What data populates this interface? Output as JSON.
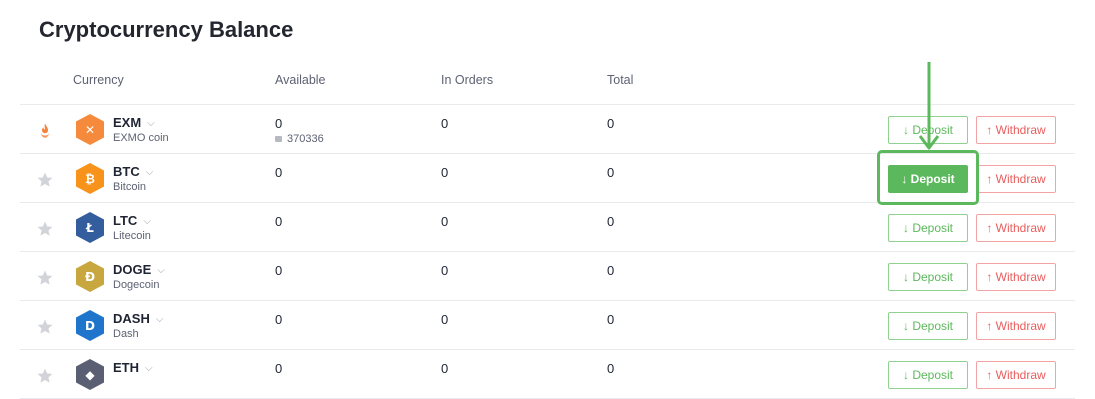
{
  "page": {
    "title": "Cryptocurrency Balance"
  },
  "columns": {
    "currency": "Currency",
    "available": "Available",
    "in_orders": "In Orders",
    "total": "Total"
  },
  "actions": {
    "deposit": "↓ Deposit",
    "withdraw": "↑ Withdraw"
  },
  "rows": [
    {
      "ticker": "EXM",
      "name": "EXMO coin",
      "available": "0",
      "locked": "370336",
      "in_orders": "0",
      "total": "0",
      "icon": "exmo-coin-icon",
      "icon_color": "#f58a3c",
      "glyph": "✕",
      "favorite_icon": "fire-icon",
      "deposit_active": false
    },
    {
      "ticker": "BTC",
      "name": "Bitcoin",
      "available": "0",
      "in_orders": "0",
      "total": "0",
      "icon": "bitcoin-icon",
      "icon_color": "#f7931a",
      "glyph": "₿",
      "favorite_icon": "star-icon",
      "deposit_active": true
    },
    {
      "ticker": "LTC",
      "name": "Litecoin",
      "available": "0",
      "in_orders": "0",
      "total": "0",
      "icon": "litecoin-icon",
      "icon_color": "#345d9d",
      "glyph": "Ł",
      "favorite_icon": "star-icon",
      "deposit_active": false
    },
    {
      "ticker": "DOGE",
      "name": "Dogecoin",
      "available": "0",
      "in_orders": "0",
      "total": "0",
      "icon": "dogecoin-icon",
      "icon_color": "#c8a83e",
      "glyph": "Đ",
      "favorite_icon": "star-icon",
      "deposit_active": false
    },
    {
      "ticker": "DASH",
      "name": "Dash",
      "available": "0",
      "in_orders": "0",
      "total": "0",
      "icon": "dash-icon",
      "icon_color": "#1f75cc",
      "glyph": "D",
      "favorite_icon": "star-icon",
      "deposit_active": false
    },
    {
      "ticker": "ETH",
      "name": "",
      "available": "0",
      "in_orders": "0",
      "total": "0",
      "icon": "ethereum-icon",
      "icon_color": "#5b5f73",
      "glyph": "◆",
      "favorite_icon": "star-icon",
      "deposit_active": false
    }
  ],
  "colors": {
    "deposit": "#5cb85c",
    "withdraw": "#ea5d5d",
    "star": "#d2d4da",
    "fire": "#f5823a"
  }
}
